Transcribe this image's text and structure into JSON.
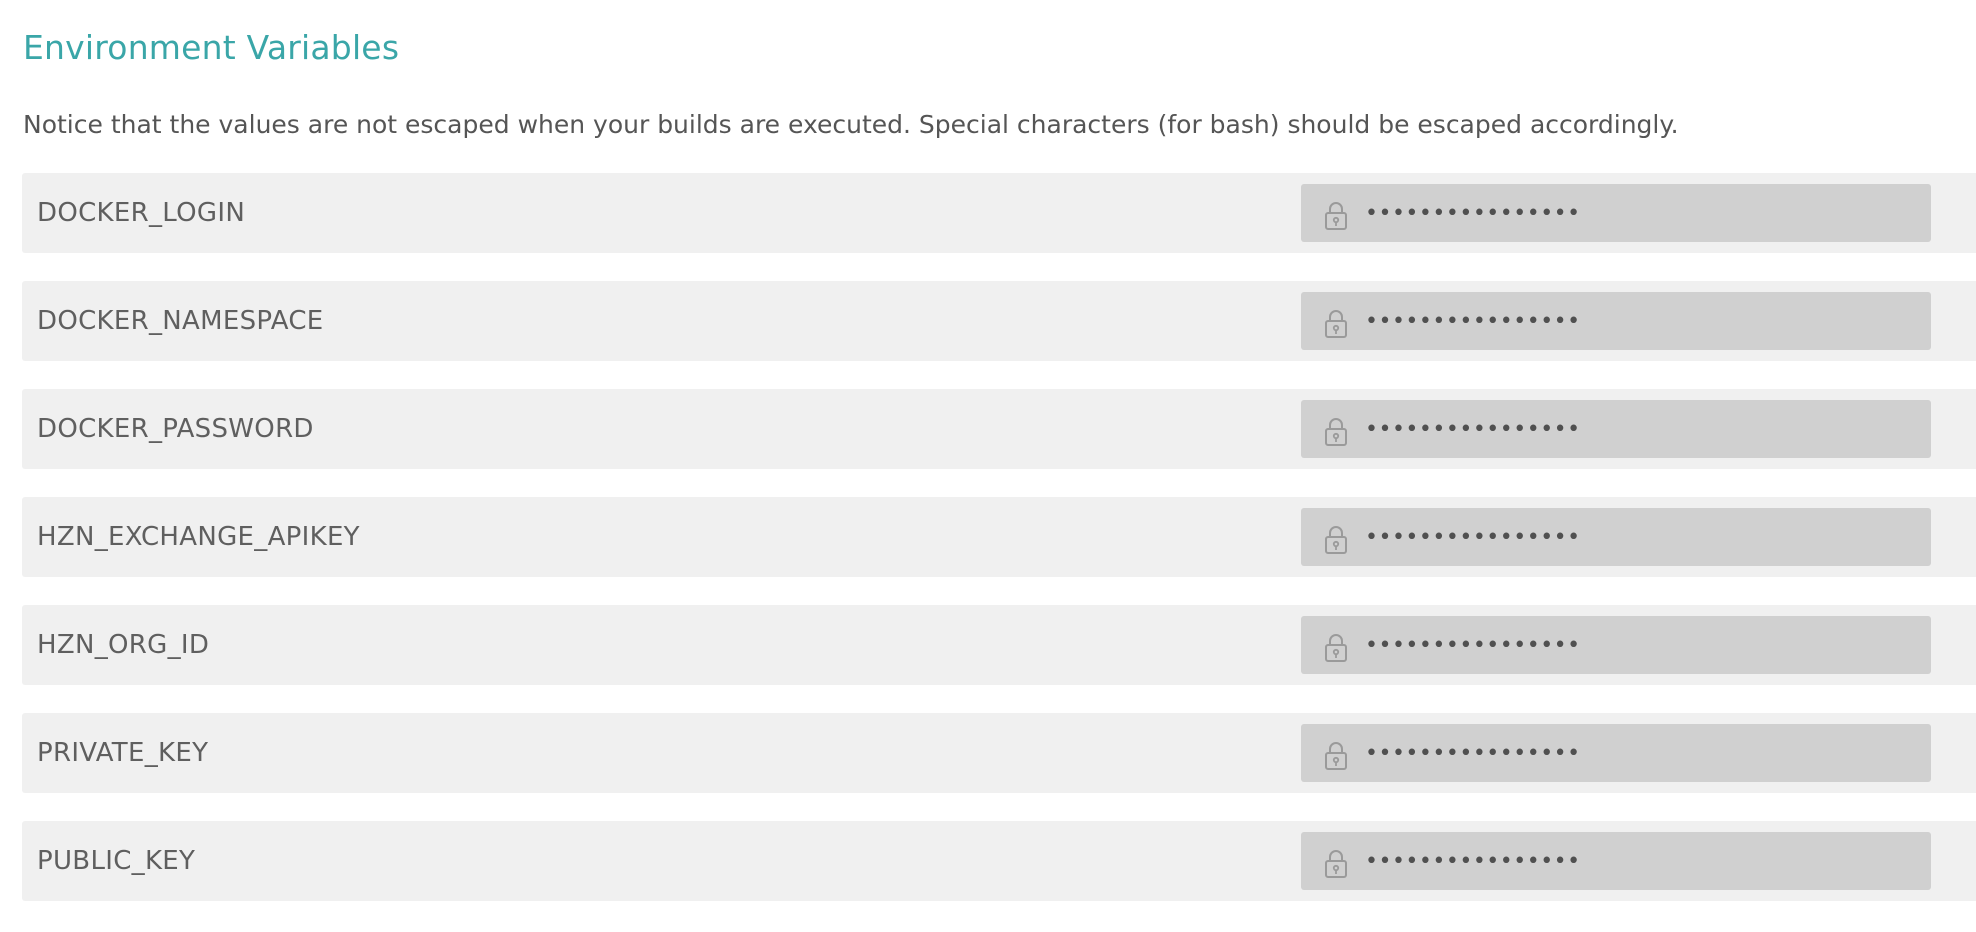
{
  "section": {
    "title": "Environment Variables",
    "notice": "Notice that the values are not escaped when your builds are executed. Special characters (for bash) should be escaped accordingly."
  },
  "variables": [
    {
      "name": "DOCKER_LOGIN",
      "value": "••••••••••••••••"
    },
    {
      "name": "DOCKER_NAMESPACE",
      "value": "••••••••••••••••"
    },
    {
      "name": "DOCKER_PASSWORD",
      "value": "••••••••••••••••"
    },
    {
      "name": "HZN_EXCHANGE_APIKEY",
      "value": "••••••••••••••••"
    },
    {
      "name": "HZN_ORG_ID",
      "value": "••••••••••••••••"
    },
    {
      "name": "PRIVATE_KEY",
      "value": "••••••••••••••••"
    },
    {
      "name": "PUBLIC_KEY",
      "value": "••••••••••••••••"
    }
  ],
  "icons": {
    "value_lock": "lock-icon"
  },
  "colors": {
    "title": "#3aa6a8",
    "row_background": "#f0f0f0",
    "value_field_background": "#d0d0d0",
    "text": "#5f5f5f"
  }
}
